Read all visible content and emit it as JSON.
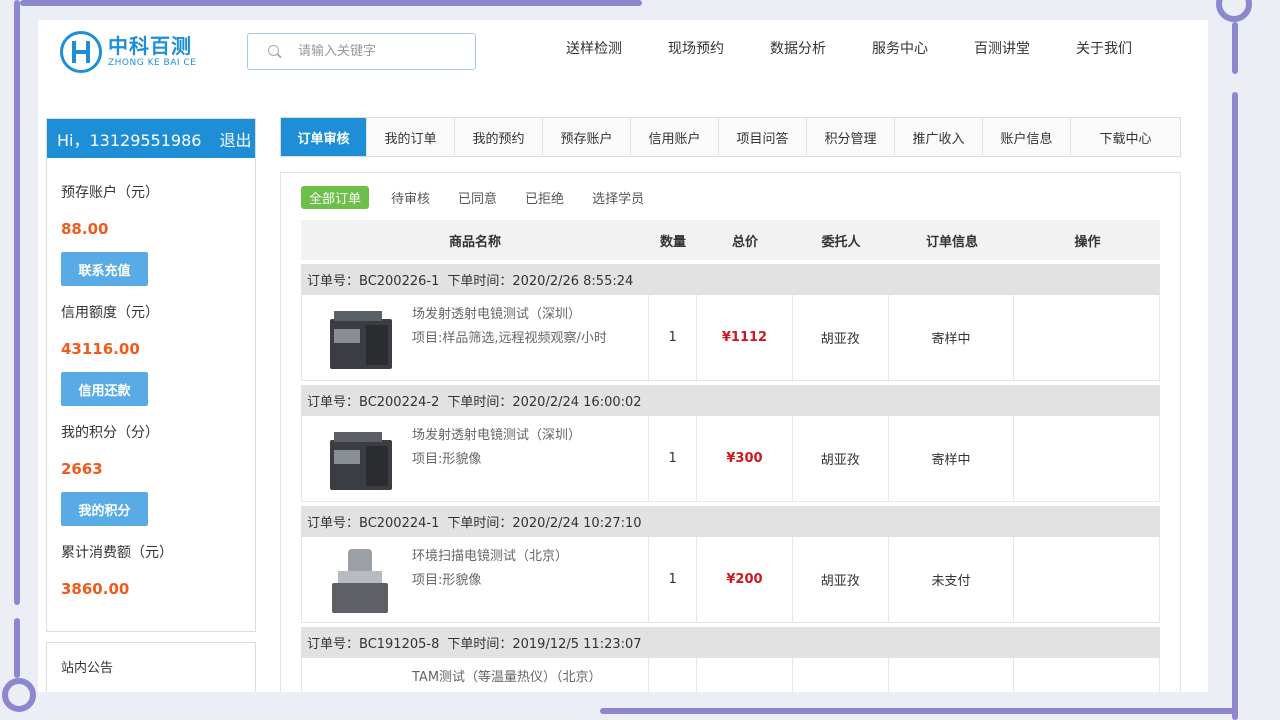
{
  "header": {
    "logo_cn": "中科百测",
    "logo_en": "ZHONG KE BAI CE",
    "search_placeholder": "请输入关键字",
    "nav": [
      "送样检测",
      "现场预约",
      "数据分析",
      "服务中心",
      "百测讲堂",
      "关于我们"
    ]
  },
  "sidebar": {
    "greeting": "Hi，13129551986",
    "logout": "退出",
    "prepaid_label": "预存账户（元）",
    "prepaid_value": "88.00",
    "recharge_button": "联系充值",
    "credit_label": "信用额度（元）",
    "credit_value": "43116.00",
    "repay_button": "信用还款",
    "points_label": "我的积分（分）",
    "points_value": "2663",
    "points_button": "我的积分",
    "spend_label": "累计消费额（元）",
    "spend_value": "3860.00",
    "notice_title": "站内公告"
  },
  "tabs": [
    "订单审核",
    "我的订单",
    "我的预约",
    "预存账户",
    "信用账户",
    "项目问答",
    "积分管理",
    "推广收入",
    "账户信息",
    "下载中心"
  ],
  "filters": [
    "全部订单",
    "待审核",
    "已同意",
    "已拒绝",
    "选择学员"
  ],
  "table": {
    "headers": [
      "商品名称",
      "数量",
      "总价",
      "委托人",
      "订单信息",
      "操作"
    ]
  },
  "orders": [
    {
      "order_no": "订单号：BC200226-1",
      "time": "下单时间：2020/2/26 8:55:24",
      "product": "场发射透射电镜测试（深圳）",
      "project": "项目:样品筛选,远程视频观察/小时",
      "qty": "1",
      "price": "¥1112",
      "client": "胡亚孜",
      "status": "寄样中",
      "image": "tem-instrument"
    },
    {
      "order_no": "订单号：BC200224-2",
      "time": "下单时间：2020/2/24 16:00:02",
      "product": "场发射透射电镜测试（深圳）",
      "project": "项目:形貌像",
      "qty": "1",
      "price": "¥300",
      "client": "胡亚孜",
      "status": "寄样中",
      "image": "tem-instrument"
    },
    {
      "order_no": "订单号：BC200224-1",
      "time": "下单时间：2020/2/24 10:27:10",
      "product": "环境扫描电镜测试（北京）",
      "project": "项目:形貌像",
      "qty": "1",
      "price": "¥200",
      "client": "胡亚孜",
      "status": "未支付",
      "image": "sem-instrument"
    },
    {
      "order_no": "订单号：BC191205-8",
      "time": "下单时间：2019/12/5 11:23:07",
      "product": "TAM测试（等温量热仪）（北京）",
      "project": "",
      "qty": "",
      "price": "",
      "client": "",
      "status": "",
      "image": "tam-instrument"
    }
  ]
}
